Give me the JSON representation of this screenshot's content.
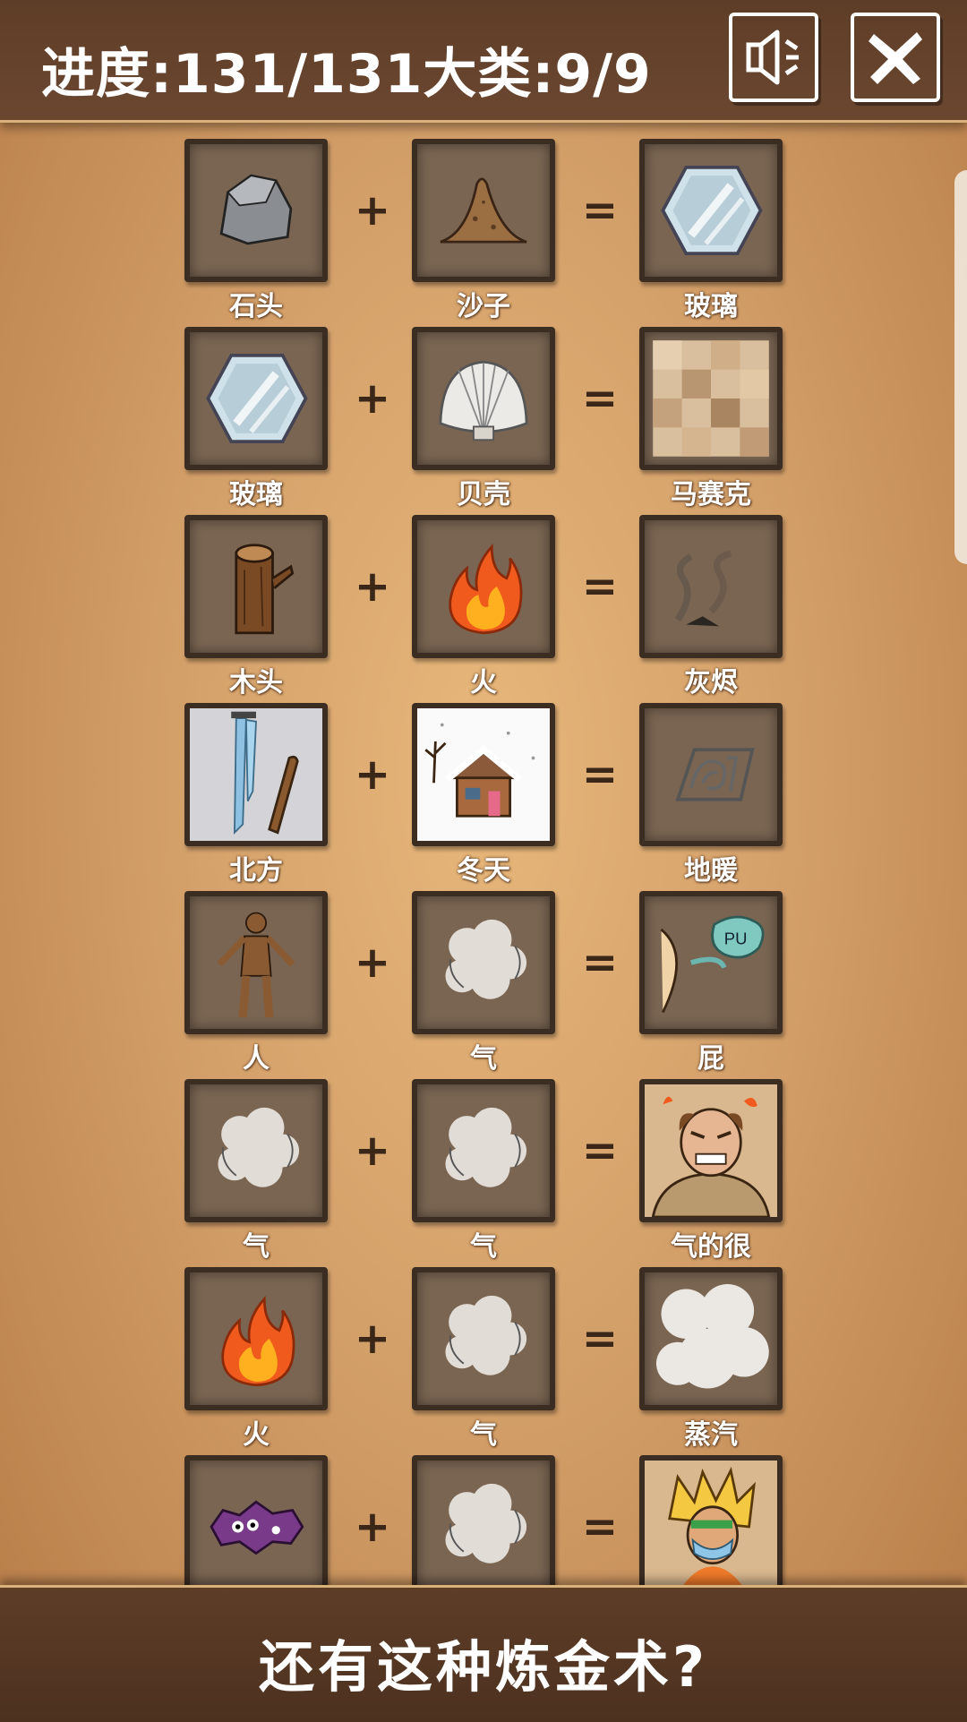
{
  "header": {
    "progress_text": "进度:131/131大类:9/9",
    "sound_icon": "speaker-muted-icon",
    "close_icon": "close-x-icon"
  },
  "recipes": [
    {
      "a": {
        "label": "石头",
        "icon": "stone-icon"
      },
      "b": {
        "label": "沙子",
        "icon": "sand-pile-icon"
      },
      "result": {
        "label": "玻璃",
        "icon": "glass-icon"
      }
    },
    {
      "a": {
        "label": "玻璃",
        "icon": "glass-icon"
      },
      "b": {
        "label": "贝壳",
        "icon": "seashell-icon"
      },
      "result": {
        "label": "马赛克",
        "icon": "mosaic-icon"
      }
    },
    {
      "a": {
        "label": "木头",
        "icon": "wood-log-icon"
      },
      "b": {
        "label": "火",
        "icon": "fire-icon"
      },
      "result": {
        "label": "灰烬",
        "icon": "ash-smoke-icon"
      }
    },
    {
      "a": {
        "label": "北方",
        "icon": "icicle-north-icon"
      },
      "b": {
        "label": "冬天",
        "icon": "snowy-house-icon"
      },
      "result": {
        "label": "地暖",
        "icon": "floor-heating-icon"
      }
    },
    {
      "a": {
        "label": "人",
        "icon": "human-figure-icon"
      },
      "b": {
        "label": "气",
        "icon": "gas-cloud-icon"
      },
      "result": {
        "label": "屁",
        "icon": "fart-pu-icon"
      }
    },
    {
      "a": {
        "label": "气",
        "icon": "gas-cloud-icon"
      },
      "b": {
        "label": "气",
        "icon": "gas-cloud-icon"
      },
      "result": {
        "label": "气的很",
        "icon": "angry-man-icon"
      }
    },
    {
      "a": {
        "label": "火",
        "icon": "fire-icon"
      },
      "b": {
        "label": "气",
        "icon": "gas-cloud-icon"
      },
      "result": {
        "label": "蒸汽",
        "icon": "steam-icon"
      }
    },
    {
      "a": {
        "label": "",
        "icon": "purple-germ-icon"
      },
      "b": {
        "label": "",
        "icon": "gas-cloud-icon"
      },
      "result": {
        "label": "",
        "icon": "masked-hero-icon"
      }
    }
  ],
  "operators": {
    "plus": "+",
    "equals": "="
  },
  "footer": {
    "title": "还有这种炼金术?"
  },
  "colors": {
    "header_bg": "#5e3d27",
    "parchment": "#d4a06a",
    "tile_border": "#3c2d22",
    "tile_bg": "#7a6552"
  }
}
